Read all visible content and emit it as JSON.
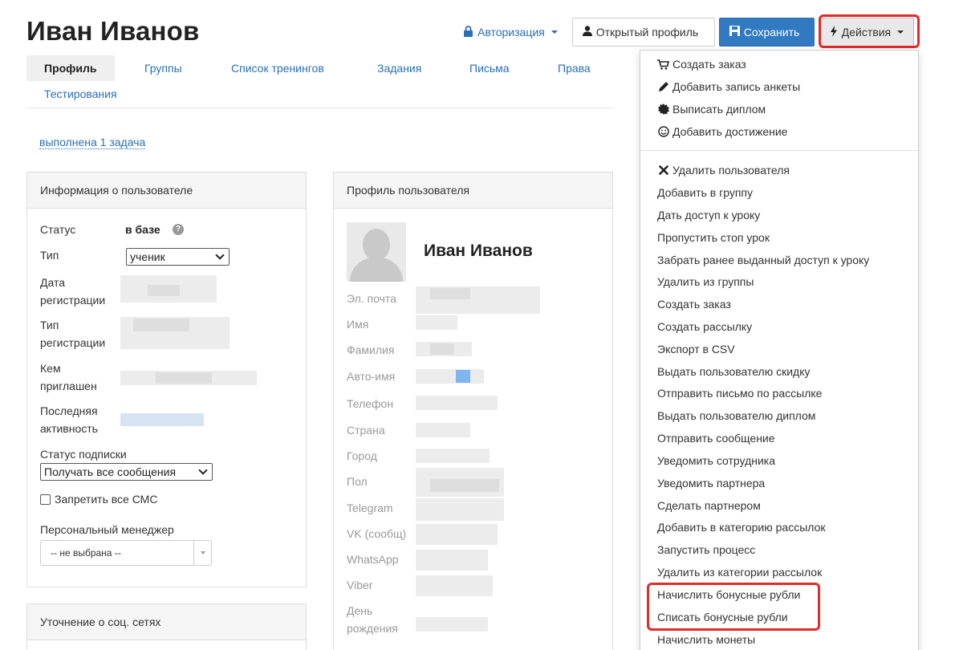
{
  "header": {
    "title": "Иван Иванов",
    "auth_label": "Авторизация",
    "open_profile_label": "Открытый профиль",
    "save_label": "Сохранить",
    "actions_label": "Действия"
  },
  "tabs": [
    {
      "label": "Профиль",
      "active": true
    },
    {
      "label": "Группы"
    },
    {
      "label": "Список тренингов"
    },
    {
      "label": "Задания"
    },
    {
      "label": "Письма"
    },
    {
      "label": "Права"
    },
    {
      "label": "Тестирования"
    }
  ],
  "task_link": "выполнена 1 задача",
  "info_panel": {
    "title": "Информация о пользователе",
    "status_label": "Статус",
    "status_value": "в базе",
    "type_label": "Тип",
    "type_value": "ученик",
    "reg_date_label_1": "Дата",
    "reg_date_label_2": "регистрации",
    "reg_type_label_1": "Тип",
    "reg_type_label_2": "регистрации",
    "invited_label_1": "Кем",
    "invited_label_2": "приглашен",
    "last_activity_label_1": "Последняя",
    "last_activity_label_2": "активность",
    "subscription_label": "Статус подписки",
    "subscription_value": "Получать все сообщения",
    "sms_label": "Запретить все СМС",
    "manager_label": "Персональный менеджер",
    "manager_value": "-- не выбрана --"
  },
  "social_panel": {
    "title": "Уточнение о соц. сетях"
  },
  "profile_panel": {
    "title": "Профиль пользователя",
    "name": "Иван Иванов",
    "fields": {
      "email": "Эл. почта",
      "first_name": "Имя",
      "last_name": "Фамилия",
      "auto_name": "Авто-имя",
      "phone": "Телефон",
      "country": "Страна",
      "city": "Город",
      "gender": "Пол",
      "telegram": "Telegram",
      "vk": "VK (сообщ)",
      "whatsapp": "WhatsApp",
      "viber": "Viber",
      "birthday_1": "День",
      "birthday_2": "рождения"
    }
  },
  "actions_menu": {
    "top_items": [
      {
        "label": "Создать заказ",
        "icon": "cart-icon"
      },
      {
        "label": "Добавить запись анкеты",
        "icon": "pencil-icon"
      },
      {
        "label": "Выписать диплом",
        "icon": "certificate-icon"
      },
      {
        "label": "Добавить достижение",
        "icon": "smile-icon"
      }
    ],
    "items": [
      {
        "label": "Удалить пользователя",
        "icon": "remove-icon"
      },
      {
        "label": "Добавить в группу"
      },
      {
        "label": "Дать доступ к уроку"
      },
      {
        "label": "Пропустить стоп урок"
      },
      {
        "label": "Забрать ранее выданный доступ к уроку"
      },
      {
        "label": "Удалить из группы"
      },
      {
        "label": "Создать заказ"
      },
      {
        "label": "Создать рассылку"
      },
      {
        "label": "Экспорт в CSV"
      },
      {
        "label": "Выдать пользователю скидку"
      },
      {
        "label": "Отправить письмо по рассылке"
      },
      {
        "label": "Выдать пользователю диплом"
      },
      {
        "label": "Отправить сообщение"
      },
      {
        "label": "Уведомить сотрудника"
      },
      {
        "label": "Уведомить партнера"
      },
      {
        "label": "Сделать партнером"
      },
      {
        "label": "Добавить в категорию рассылок"
      },
      {
        "label": "Запустить процесс"
      },
      {
        "label": "Удалить из категории рассылок"
      },
      {
        "label": "Начислить бонусные рубли"
      },
      {
        "label": "Списать бонусные рубли"
      },
      {
        "label": "Начислить монеты"
      }
    ]
  },
  "colors": {
    "accent_blue": "#2a6fb5",
    "save_button": "#3179c0",
    "highlight_red": "#e02b2b"
  }
}
